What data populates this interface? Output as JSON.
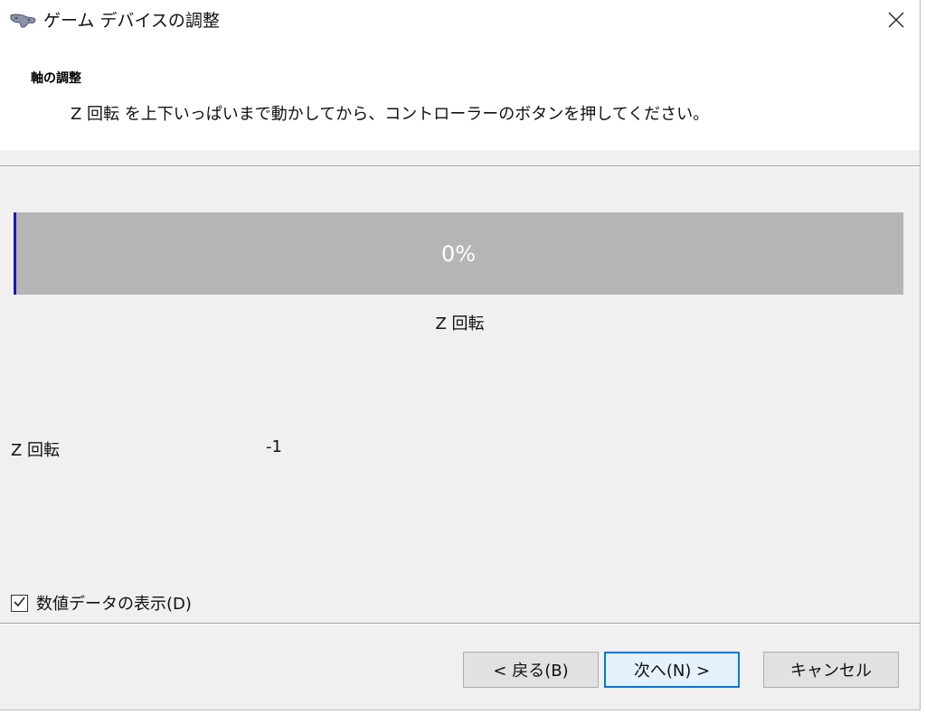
{
  "window": {
    "title": "ゲーム デバイスの調整",
    "close_glyph": "✕"
  },
  "header": {
    "title": "軸の調整",
    "instruction": "Z 回転 を上下いっぱいまで動かしてから、コントローラーのボタンを押してください。"
  },
  "axis": {
    "progress_label": "0%",
    "progress_fraction": 0.0,
    "caption": "Z 回転",
    "readout_label": "Z 回転",
    "readout_value": "-1"
  },
  "options": {
    "show_numeric_label": "数値データの表示(D)",
    "show_numeric_checked": true
  },
  "buttons": {
    "back": "< 戻る(B)",
    "next": "次へ(N) >",
    "cancel": "キャンセル"
  },
  "colors": {
    "progress_bg": "#b5b5b5",
    "progress_fill": "#1a1ab8",
    "default_button_border": "#0078d7"
  },
  "icons": {
    "app": "gamepad-icon",
    "close": "close-icon",
    "check": "check-icon"
  }
}
